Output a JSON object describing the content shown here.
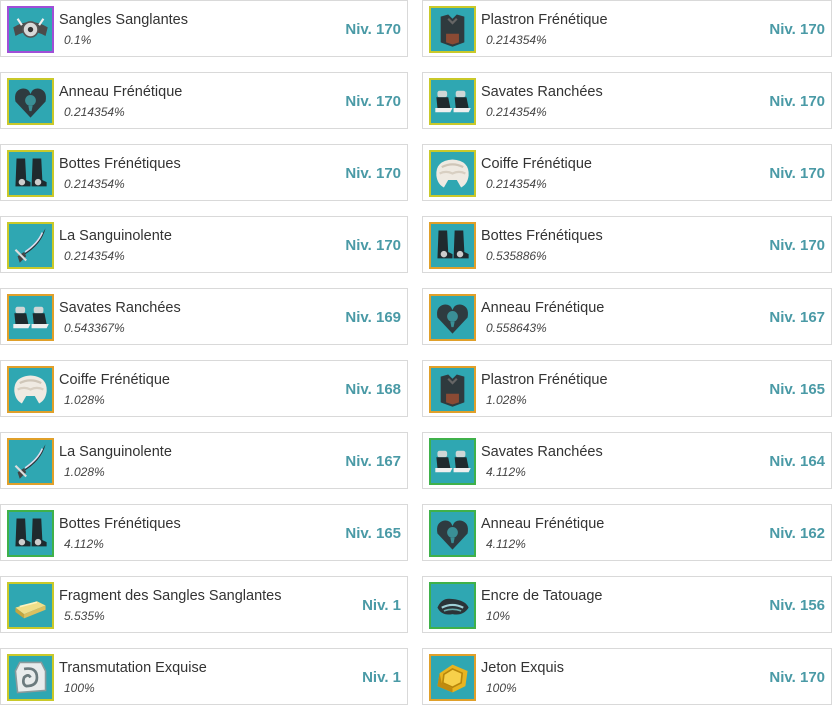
{
  "colors": {
    "level_text": "#4a9aa6",
    "icon_bg": "#2fa7b2",
    "frame_yellow": "#c9c92a",
    "frame_green": "#3fb14a",
    "frame_purple": "#a04fd8",
    "frame_orange": "#e0a02a"
  },
  "drops": [
    {
      "name": "Sangles Sanglantes",
      "rate": "0.1%",
      "level": "Niv. 170",
      "icon": "belt-icon",
      "frame": "purple"
    },
    {
      "name": "Plastron Frénétique",
      "rate": "0.214354%",
      "level": "Niv. 170",
      "icon": "breastplate-icon",
      "frame": "yellow"
    },
    {
      "name": "Anneau Frénétique",
      "rate": "0.214354%",
      "level": "Niv. 170",
      "icon": "ring-icon",
      "frame": "yellow"
    },
    {
      "name": "Savates Ranchées",
      "rate": "0.214354%",
      "level": "Niv. 170",
      "icon": "shoes-icon",
      "frame": "yellow"
    },
    {
      "name": "Bottes Frénétiques",
      "rate": "0.214354%",
      "level": "Niv. 170",
      "icon": "boots-icon",
      "frame": "yellow"
    },
    {
      "name": "Coiffe Frénétique",
      "rate": "0.214354%",
      "level": "Niv. 170",
      "icon": "helmet-icon",
      "frame": "yellow"
    },
    {
      "name": "La Sanguinolente",
      "rate": "0.214354%",
      "level": "Niv. 170",
      "icon": "dagger-icon",
      "frame": "yellow"
    },
    {
      "name": "Bottes Frénétiques",
      "rate": "0.535886%",
      "level": "Niv. 170",
      "icon": "boots-icon",
      "frame": "orange"
    },
    {
      "name": "Savates Ranchées",
      "rate": "0.543367%",
      "level": "Niv. 169",
      "icon": "shoes-icon",
      "frame": "orange"
    },
    {
      "name": "Anneau Frénétique",
      "rate": "0.558643%",
      "level": "Niv. 167",
      "icon": "ring-icon",
      "frame": "orange"
    },
    {
      "name": "Coiffe Frénétique",
      "rate": "1.028%",
      "level": "Niv. 168",
      "icon": "helmet-icon",
      "frame": "orange"
    },
    {
      "name": "Plastron Frénétique",
      "rate": "1.028%",
      "level": "Niv. 165",
      "icon": "breastplate-icon",
      "frame": "orange"
    },
    {
      "name": "La Sanguinolente",
      "rate": "1.028%",
      "level": "Niv. 167",
      "icon": "dagger-icon",
      "frame": "orange"
    },
    {
      "name": "Savates Ranchées",
      "rate": "4.112%",
      "level": "Niv. 164",
      "icon": "shoes-icon",
      "frame": "green"
    },
    {
      "name": "Bottes Frénétiques",
      "rate": "4.112%",
      "level": "Niv. 165",
      "icon": "boots-icon",
      "frame": "green"
    },
    {
      "name": "Anneau Frénétique",
      "rate": "4.112%",
      "level": "Niv. 162",
      "icon": "ring-icon",
      "frame": "green"
    },
    {
      "name": "Fragment des Sangles Sanglantes",
      "rate": "5.535%",
      "level": "Niv. 1",
      "icon": "ingot-icon",
      "frame": "yellow"
    },
    {
      "name": "Encre de Tatouage",
      "rate": "10%",
      "level": "Niv. 156",
      "icon": "ink-icon",
      "frame": "green"
    },
    {
      "name": "Transmutation Exquise",
      "rate": "100%",
      "level": "Niv. 1",
      "icon": "rune-icon",
      "frame": "yellow"
    },
    {
      "name": "Jeton Exquis",
      "rate": "100%",
      "level": "Niv. 170",
      "icon": "token-icon",
      "frame": "orange"
    }
  ]
}
